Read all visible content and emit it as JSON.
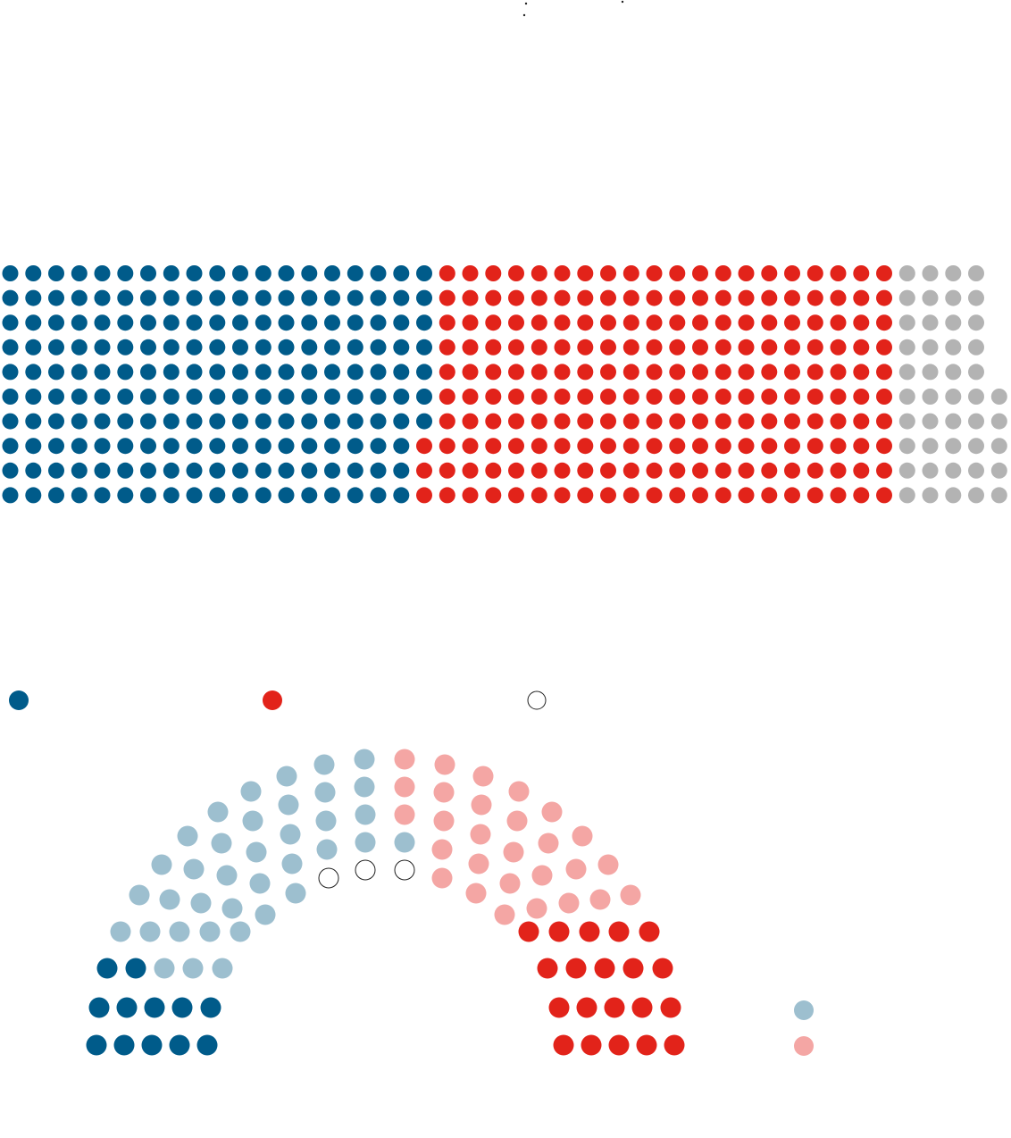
{
  "colors": {
    "democrat": "#005b8a",
    "republican": "#e2231a",
    "other": "#b3b3b3",
    "democrat_light": "#9dbfcf",
    "republican_light": "#f4a6a4",
    "vacant_stroke": "#222222",
    "background": "#ffffff"
  },
  "waffle": {
    "rows": 10,
    "columns_by_row": [
      {
        "democrat": 19,
        "republican": 20,
        "other": 4
      },
      {
        "democrat": 19,
        "republican": 20,
        "other": 4
      },
      {
        "democrat": 19,
        "republican": 20,
        "other": 4
      },
      {
        "democrat": 19,
        "republican": 20,
        "other": 4
      },
      {
        "democrat": 19,
        "republican": 20,
        "other": 4
      },
      {
        "democrat": 19,
        "republican": 20,
        "other": 5
      },
      {
        "democrat": 19,
        "republican": 20,
        "other": 5
      },
      {
        "democrat": 18,
        "republican": 21,
        "other": 5
      },
      {
        "democrat": 18,
        "republican": 21,
        "other": 5
      },
      {
        "democrat": 18,
        "republican": 21,
        "other": 5
      }
    ]
  },
  "legend": {
    "items": [
      {
        "icon": "filled-dot",
        "color_key": "democrat"
      },
      {
        "icon": "filled-dot",
        "color_key": "republican"
      },
      {
        "icon": "open-circle",
        "color_key": "vacant_stroke"
      }
    ]
  },
  "senate": {
    "rows": [
      {
        "seats": [
          "democrat",
          "democrat",
          "democrat",
          "democrat",
          "democrat",
          "republican",
          "republican",
          "republican",
          "republican",
          "republican"
        ]
      },
      {
        "seats": [
          "democrat",
          "democrat",
          "democrat",
          "democrat",
          "democrat",
          "republican",
          "republican",
          "republican",
          "republican",
          "republican"
        ]
      },
      {
        "seats": [
          "democrat",
          "democrat",
          "democrat_light",
          "democrat_light",
          "democrat_light",
          "republican",
          "republican",
          "republican",
          "republican",
          "republican"
        ]
      },
      {
        "seats": [
          "democrat_light",
          "democrat_light",
          "democrat_light",
          "democrat_light",
          "democrat_light",
          "republican",
          "republican",
          "republican",
          "republican",
          "republican"
        ]
      },
      {
        "seats": [
          "democrat_light",
          "democrat_light",
          "democrat_light",
          "democrat_light",
          "democrat_light",
          "republican_light",
          "republican_light",
          "republican_light",
          "republican_light",
          "republican_light"
        ]
      },
      {
        "seats": [
          "democrat_light",
          "democrat_light",
          "democrat_light",
          "democrat_light",
          "democrat_light",
          "vacant",
          "republican_light",
          "republican_light",
          "republican_light",
          "republican_light",
          "republican_light",
          "republican_light"
        ]
      },
      {
        "seats": [
          "democrat_light",
          "democrat_light",
          "democrat_light",
          "democrat_light",
          "democrat_light",
          "vacant",
          "vacant",
          "republican_light",
          "republican_light",
          "republican_light",
          "republican_light",
          "republican_light",
          "republican_light"
        ]
      },
      {
        "seats": [
          "democrat_light",
          "democrat_light",
          "democrat_light",
          "democrat_light",
          "democrat_light",
          "republican_light",
          "republican_light",
          "republican_light",
          "republican_light",
          "republican_light"
        ]
      },
      {
        "seats": [
          "democrat_light",
          "democrat_light",
          "democrat_light",
          "democrat_light",
          "republican_light",
          "republican_light",
          "republican_light",
          "republican_light"
        ]
      },
      {
        "seats": [
          "democrat_light",
          "democrat_light",
          "democrat_light",
          "democrat_light",
          "republican_light",
          "republican_light",
          "republican_light",
          "republican_light"
        ]
      }
    ]
  },
  "senate_key": {
    "items": [
      {
        "icon": "filled-dot",
        "color_key": "democrat_light"
      },
      {
        "icon": "filled-dot",
        "color_key": "republican_light"
      }
    ]
  }
}
